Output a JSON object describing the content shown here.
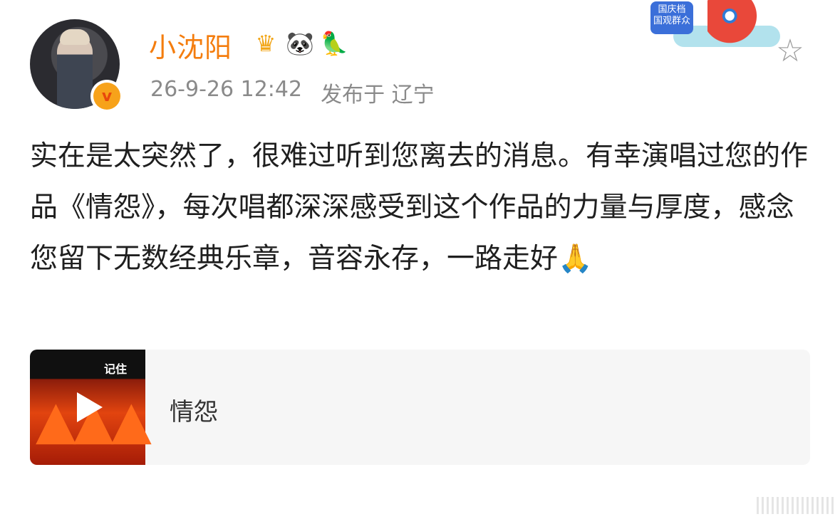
{
  "post": {
    "username": "小沈阳",
    "badges": [
      "crown-badge",
      "panda-badge",
      "parrot-badge"
    ],
    "verified_mark": "v",
    "timestamp": "26-9-26 12:42",
    "location": "发布于 辽宁",
    "text": "实在是太突然了，很难过听到您离去的消息。有幸演唱过您的作品《情怨》，每次唱都深深感受到这个作品的力量与厚度，感念您留下无数经典乐章，音容永存，一路走好🙏"
  },
  "banner": {
    "tag_line1": "国庆档",
    "tag_line2": "国观群众"
  },
  "music_card": {
    "cover_text": "记住",
    "song_title": "情怨"
  },
  "icons": {
    "favorite": "star-icon",
    "play": "play-icon"
  },
  "colors": {
    "username": "#f47d0e",
    "meta": "#8a8a8a",
    "card_bg": "#f6f6f6",
    "verified": "#f7a21a"
  }
}
